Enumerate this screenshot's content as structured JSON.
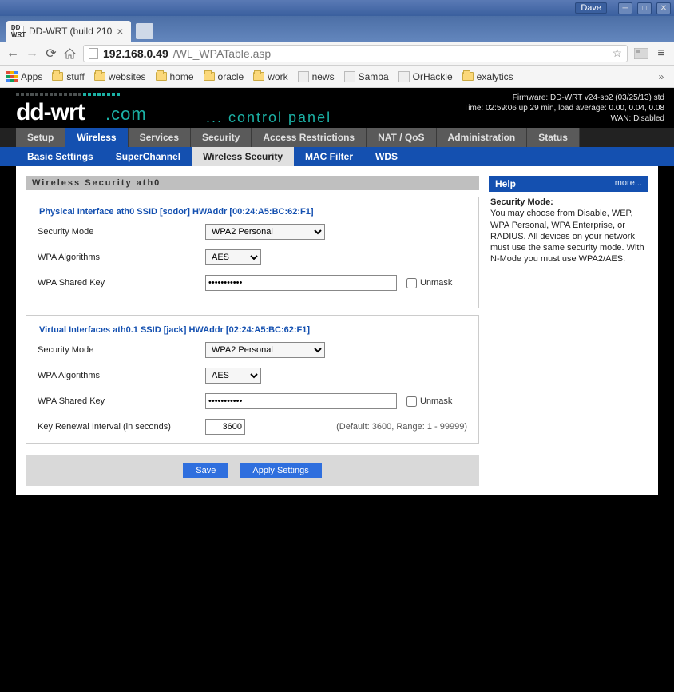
{
  "window": {
    "user": "Dave"
  },
  "browser": {
    "tab_title": "DD-WRT (build 210",
    "tab_favicon_text": "DD WRT",
    "urlbar": {
      "host": "192.168.0.49",
      "path": "/WL_WPATable.asp"
    },
    "bookmarks": {
      "apps": "Apps",
      "items": [
        "stuff",
        "websites",
        "home",
        "oracle",
        "work",
        "news",
        "Samba",
        "OrHackle",
        "exalytics"
      ]
    }
  },
  "header": {
    "control_panel": "... control panel",
    "status": {
      "firmware": "Firmware: DD-WRT v24-sp2 (03/25/13) std",
      "time": "Time: 02:59:06 up 29 min, load average: 0.00, 0.04, 0.08",
      "wan": "WAN: Disabled"
    }
  },
  "nav": {
    "main": [
      "Setup",
      "Wireless",
      "Services",
      "Security",
      "Access Restrictions",
      "NAT / QoS",
      "Administration",
      "Status"
    ],
    "main_active": "Wireless",
    "sub": [
      "Basic Settings",
      "SuperChannel",
      "Wireless Security",
      "MAC Filter",
      "WDS"
    ],
    "sub_active": "Wireless Security"
  },
  "page": {
    "title": "Wireless Security ath0",
    "physical": {
      "legend": "Physical Interface ath0 SSID [sodor] HWAddr [00:24:A5:BC:62:F1]",
      "security_mode_label": "Security Mode",
      "security_mode_value": "WPA2 Personal",
      "wpa_algo_label": "WPA Algorithms",
      "wpa_algo_value": "AES",
      "shared_key_label": "WPA Shared Key",
      "shared_key_value": "•••••••••••",
      "unmask_label": "Unmask"
    },
    "virtual": {
      "legend": "Virtual Interfaces ath0.1 SSID [jack] HWAddr [02:24:A5:BC:62:F1]",
      "security_mode_label": "Security Mode",
      "security_mode_value": "WPA2 Personal",
      "wpa_algo_label": "WPA Algorithms",
      "wpa_algo_value": "AES",
      "shared_key_label": "WPA Shared Key",
      "shared_key_value": "•••••••••••",
      "unmask_label": "Unmask",
      "key_renewal_label": "Key Renewal Interval (in seconds)",
      "key_renewal_value": "3600",
      "key_renewal_hint": "(Default: 3600, Range: 1 - 99999)"
    },
    "buttons": {
      "save": "Save",
      "apply": "Apply Settings"
    }
  },
  "help": {
    "title": "Help",
    "more": "more...",
    "heading": "Security Mode:",
    "body": "You may choose from Disable, WEP, WPA Personal, WPA Enterprise, or RADIUS. All devices on your network must use the same security mode. With N-Mode you must use WPA2/AES."
  }
}
